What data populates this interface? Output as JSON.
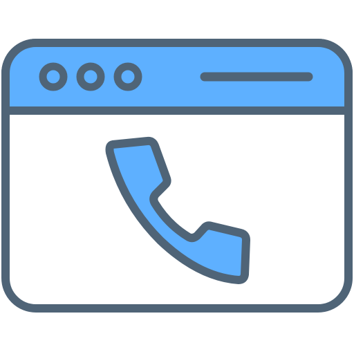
{
  "icon": {
    "name": "browser-phone-icon",
    "colors": {
      "outline": "#4f6477",
      "accent": "#5eb0ff",
      "background": "#ffffff"
    },
    "parts": {
      "window_controls": [
        "dot-icon",
        "dot-icon",
        "dot-icon"
      ],
      "address_bar": "address-bar-line",
      "content_symbol": "phone-handset-icon"
    }
  }
}
